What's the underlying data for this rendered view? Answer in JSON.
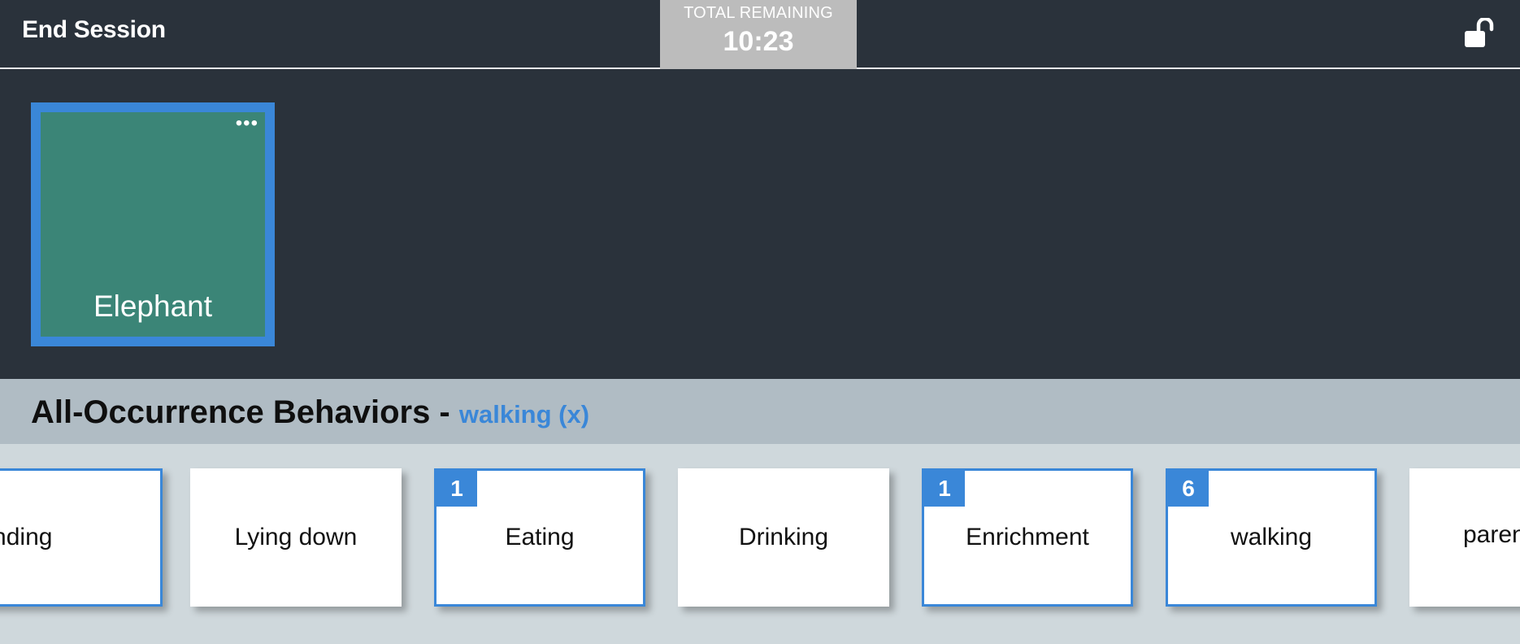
{
  "header": {
    "end_session_label": "End Session",
    "timer_label": "TOTAL REMAINING",
    "timer_value": "10:23",
    "lock_icon": "unlocked-padlock-icon"
  },
  "subject": {
    "name": "Elephant",
    "menu_glyph": "•••"
  },
  "section": {
    "title": "All-Occurrence Behaviors - ",
    "filter": "walking (x)"
  },
  "behaviors": [
    {
      "label": "Standing",
      "count": null,
      "selected": true
    },
    {
      "label": "Lying down",
      "count": null,
      "selected": false
    },
    {
      "label": "Eating",
      "count": "1",
      "selected": true
    },
    {
      "label": "Drinking",
      "count": null,
      "selected": false
    },
    {
      "label": "Enrichment",
      "count": "1",
      "selected": true
    },
    {
      "label": "walking",
      "count": "6",
      "selected": true
    },
    {
      "label": "paren",
      "count": null,
      "selected": false
    }
  ],
  "colors": {
    "background": "#2a323b",
    "accent": "#3a87d8",
    "subject_tile": "#3b8577",
    "section_header": "#b0bcc4",
    "behaviors_bg": "#cfd8dc",
    "timer_bg": "#bcbcbc"
  }
}
